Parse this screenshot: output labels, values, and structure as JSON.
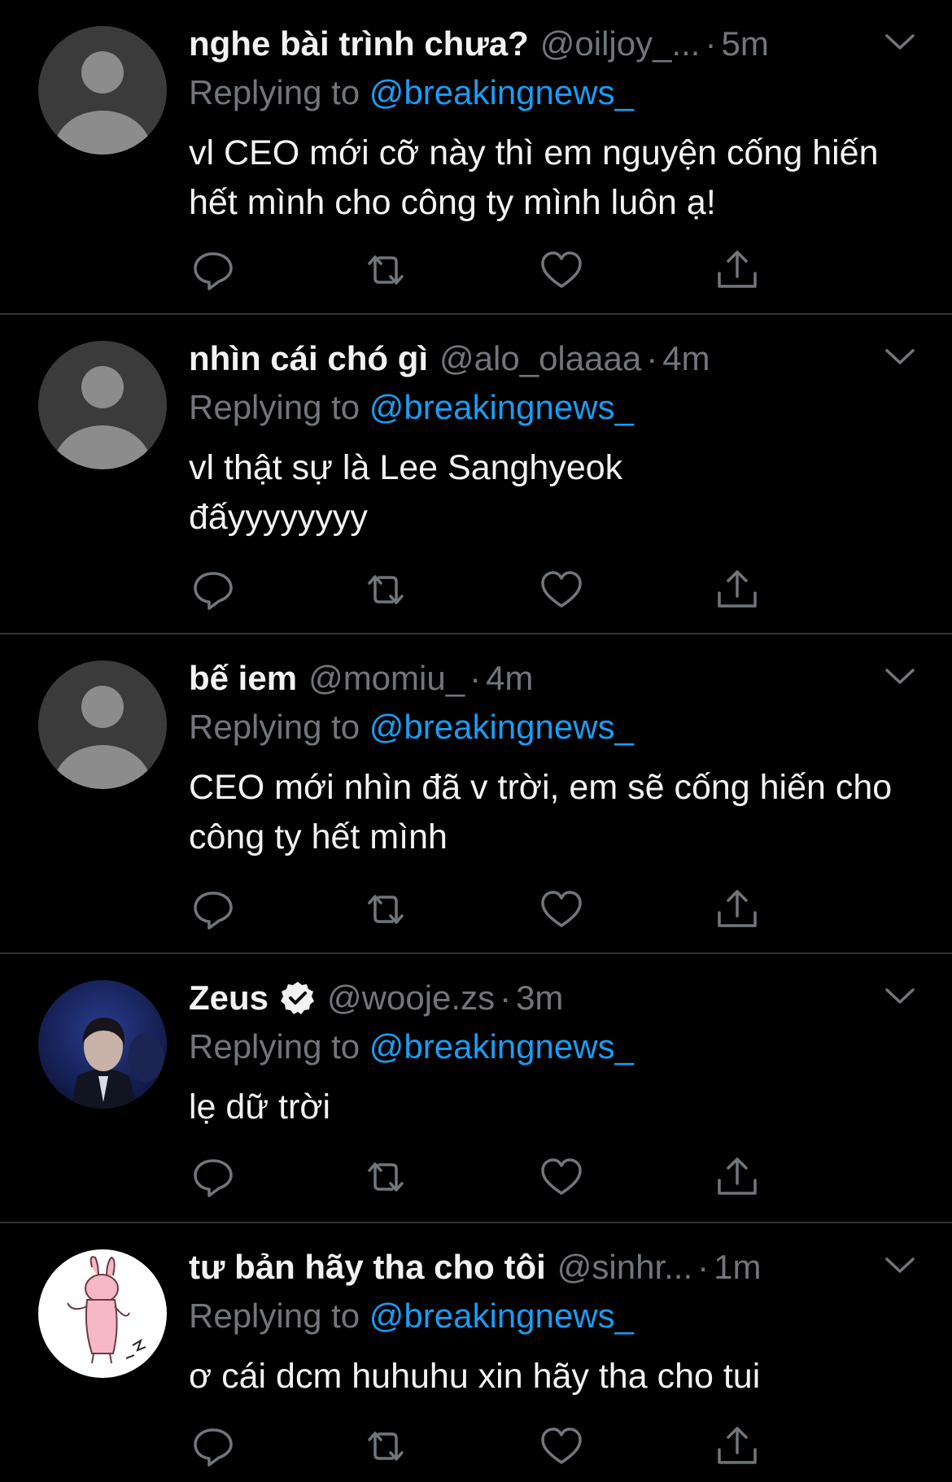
{
  "colors": {
    "background": "#000000",
    "divider": "#2f3336",
    "secondary_text": "#71767b",
    "link": "#1d9bf0",
    "primary_text": "#f2f2f2"
  },
  "tweets": [
    {
      "name": "nghe bài trình chưa?",
      "handle": "@oiljoy_...",
      "dot": "·",
      "time": "5m",
      "replying_prefix": "Replying to",
      "replying_to": "@breakingnews_",
      "text": "vl CEO mới cỡ này thì em nguyện cống hiến hết mình cho công ty mình luôn ạ!",
      "avatar": "default-avatar",
      "verified": false
    },
    {
      "name": "nhìn cái chó gì",
      "handle": "@alo_olaaaa",
      "dot": "·",
      "time": "4m",
      "replying_prefix": "Replying to",
      "replying_to": "@breakingnews_",
      "text": "vl thật sự là Lee Sanghyeok đấyyyyyyyy",
      "avatar": "default-avatar",
      "verified": false
    },
    {
      "name": "bế iem",
      "handle": "@momiu_",
      "dot": "·",
      "time": "4m",
      "replying_prefix": "Replying to",
      "replying_to": "@breakingnews_",
      "text": "CEO mới nhìn đã v trời, em sẽ cống hiến cho công ty hết mình",
      "avatar": "default-avatar",
      "verified": false
    },
    {
      "name": "Zeus",
      "handle": "@wooje.zs",
      "dot": "·",
      "time": "3m",
      "replying_prefix": "Replying to",
      "replying_to": "@breakingnews_",
      "text": "lẹ dữ trời",
      "avatar": "photo-avatar",
      "verified": true
    },
    {
      "name": "tư bản hãy tha cho tôi",
      "handle": "@sinhr...",
      "dot": "·",
      "time": "1m",
      "replying_prefix": "Replying to",
      "replying_to": "@breakingnews_",
      "text": "ơ cái dcm huhuhu xin hãy tha cho tui",
      "avatar": "drawing-avatar",
      "verified": false
    }
  ],
  "action_icons": [
    "reply-icon",
    "retweet-icon",
    "like-icon",
    "share-icon"
  ]
}
